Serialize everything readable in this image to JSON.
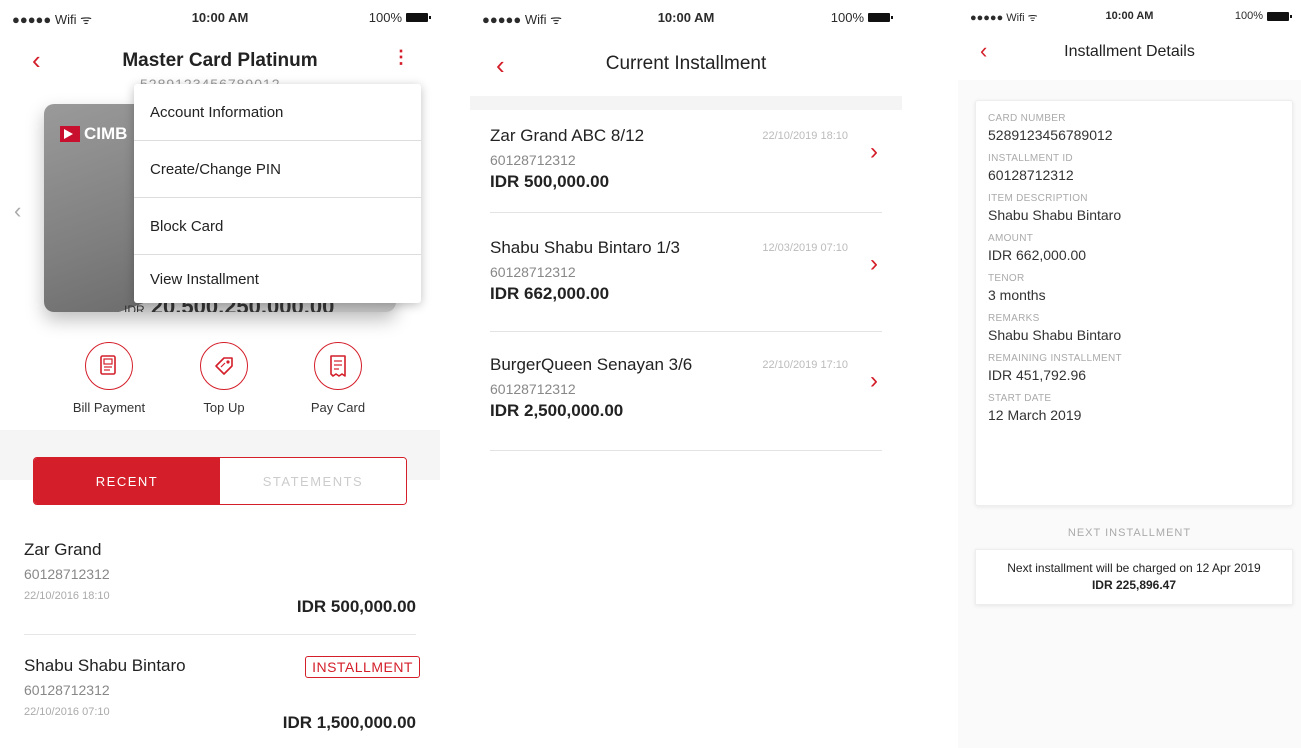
{
  "status": {
    "carrier": "●●●●● Wifi ᯤ",
    "time": "10:00 AM",
    "battery": "100%"
  },
  "screen1": {
    "title": "Master Card Platinum",
    "subnumber": "5289123456789012",
    "card_brand": "CIMB",
    "card_balance_prefix": "IDR",
    "card_balance": "20,500,250,000.00",
    "menu": [
      "Account Information",
      "Create/Change PIN",
      "Block Card",
      "View Installment"
    ],
    "actions": [
      {
        "label": "Bill Payment",
        "icon": "bill-icon"
      },
      {
        "label": "Top Up",
        "icon": "tag-icon"
      },
      {
        "label": "Pay Card",
        "icon": "receipt-icon"
      }
    ],
    "tabs": {
      "recent": "RECENT",
      "statements": "STATEMENTS"
    },
    "transactions": [
      {
        "name": "Zar Grand",
        "account": "60128712312",
        "date": "22/10/2016 18:10",
        "amount": "IDR 500,000.00"
      },
      {
        "name": "Shabu Shabu Bintaro",
        "account": "60128712312",
        "date": "22/10/2016 07:10",
        "amount": "IDR 1,500,000.00",
        "badge": "INSTALLMENT"
      }
    ]
  },
  "screen2": {
    "title": "Current Installment",
    "items": [
      {
        "name": "Zar Grand ABC 8/12",
        "account": "60128712312",
        "amount": "IDR 500,000.00",
        "date": "22/10/2019 18:10"
      },
      {
        "name": "Shabu Shabu Bintaro 1/3",
        "account": "60128712312",
        "amount": "IDR 662,000.00",
        "date": "12/03/2019 07:10"
      },
      {
        "name": "BurgerQueen Senayan 3/6",
        "account": "60128712312",
        "amount": "IDR 2,500,000.00",
        "date": "22/10/2019 17:10"
      }
    ]
  },
  "screen3": {
    "title": "Installment Details",
    "fields": [
      {
        "label": "CARD NUMBER",
        "value": "5289123456789012"
      },
      {
        "label": "INSTALLMENT ID",
        "value": "60128712312"
      },
      {
        "label": "ITEM DESCRIPTION",
        "value": "Shabu Shabu Bintaro"
      },
      {
        "label": "AMOUNT",
        "value": "IDR 662,000.00"
      },
      {
        "label": "TENOR",
        "value": "3 months"
      },
      {
        "label": "REMARKS",
        "value": "Shabu Shabu Bintaro"
      },
      {
        "label": "REMAINING INSTALLMENT",
        "value": "IDR 451,792.96"
      },
      {
        "label": "START DATE",
        "value": "12 March 2019"
      }
    ],
    "next_heading": "NEXT INSTALLMENT",
    "next_text": "Next installment will be charged on 12 Apr 2019",
    "next_amount": "IDR 225,896.47"
  },
  "colors": {
    "accent": "#d41f2a"
  }
}
